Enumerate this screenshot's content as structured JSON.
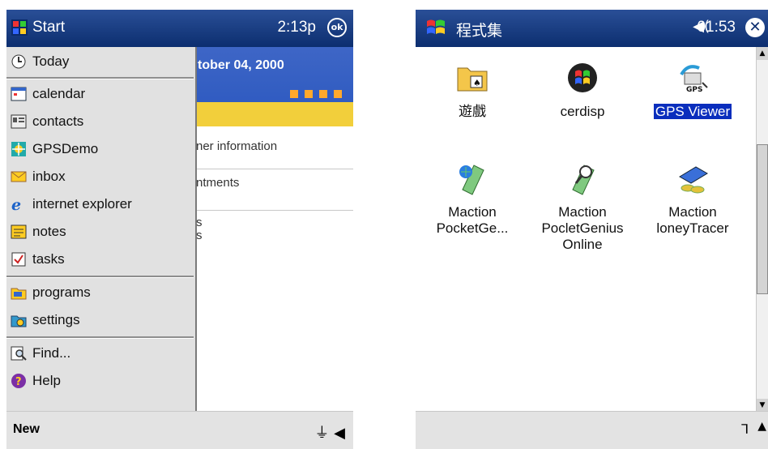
{
  "left": {
    "title": "Start",
    "time": "2:13p",
    "ok_label": "ok",
    "today": {
      "date": "tober 04, 2000",
      "row1": "ner information",
      "row2": "ntments",
      "row3a": "s",
      "row3b": "s"
    },
    "menu": {
      "today": "Today",
      "calendar": "calendar",
      "contacts": "contacts",
      "gpsdemo": "GPSDemo",
      "inbox": "inbox",
      "ie": "internet explorer",
      "notes": "notes",
      "tasks": "tasks",
      "programs": "programs",
      "settings": "settings",
      "find": "Find...",
      "help": "Help"
    },
    "bottom": {
      "new_label": "New"
    }
  },
  "right": {
    "title": "程式集",
    "time": "01:53",
    "close_label": "✕",
    "programs": [
      {
        "label": "遊戲",
        "icon": "games-folder-icon"
      },
      {
        "label": "cerdisp",
        "icon": "cerdisp-icon"
      },
      {
        "label": "GPS Viewer",
        "icon": "gps-viewer-icon"
      },
      {
        "label": "Maction PocketGe...",
        "icon": "maction-pocketgenius-icon"
      },
      {
        "label": "Maction PocletGenius Online",
        "icon": "maction-online-icon"
      },
      {
        "label": "Maction loneyTracer",
        "icon": "maction-moneytracer-icon"
      }
    ]
  },
  "colors": {
    "titlebar": "#0c2e6f",
    "selection": "#0a2ebd",
    "menu_bg": "#e1e1e1",
    "today_banner": "#2a57bf",
    "today_strip": "#f2cf3b"
  }
}
